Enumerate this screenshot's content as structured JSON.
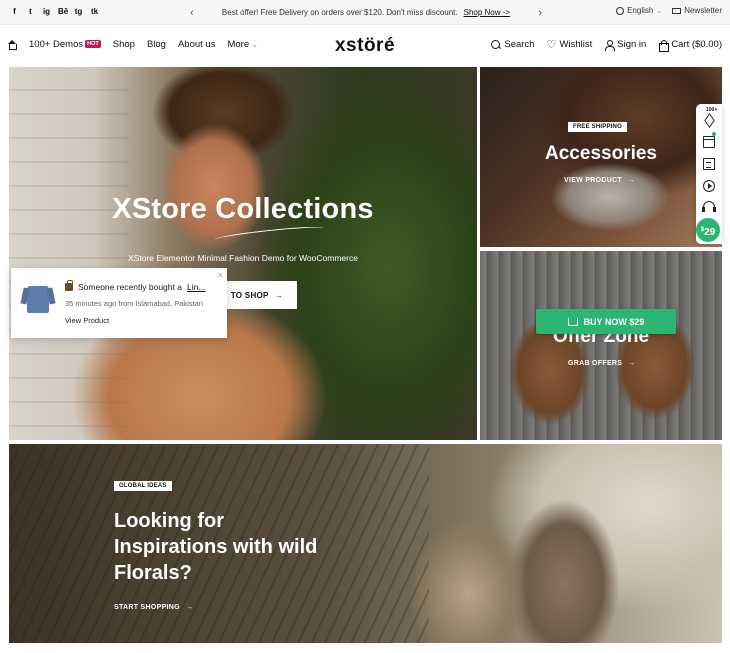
{
  "topbar": {
    "socials": [
      "f",
      "t",
      "ig",
      "Bē",
      "tg",
      "tk"
    ],
    "social_names": [
      "facebook-icon",
      "twitter-icon",
      "instagram-icon",
      "behance-icon",
      "telegram-icon",
      "tiktok-icon"
    ],
    "promo_text": "Best offer! Free Delivery on orders over $120. Don't miss discount.",
    "promo_link": "Shop Now ->",
    "prev_arrow": "‹",
    "next_arrow": "›",
    "language": "English",
    "language_chevron": "⌄",
    "newsletter": "Newsletter"
  },
  "header": {
    "nav": {
      "demos": "100+ Demos",
      "hot": "HOT",
      "shop": "Shop",
      "blog": "Blog",
      "about": "About us",
      "more": "More",
      "more_chevron": "⌄"
    },
    "logo": "xstöré",
    "actions": {
      "search": "Search",
      "wishlist": "Wishlist",
      "sign_in": "Sign in",
      "cart": "Cart ($0.00)"
    }
  },
  "hero": {
    "title": "XStore Collections",
    "subtitle": "XStore Elementor Minimal Fashion Demo for WooCommerce",
    "button": "TO SHOP",
    "button_arrow": "→"
  },
  "accessories": {
    "badge": "FREE SHIPPING",
    "title": "Accessories",
    "link": "VIEW PRODUCT",
    "arrow": "→"
  },
  "offer": {
    "title": "Offer Zone",
    "link": "GRAB OFFERS",
    "arrow": "→",
    "buy_button": "BUY NOW $29"
  },
  "banner": {
    "badge": "GLOBAL IDEAS",
    "title_lines": [
      "Looking for",
      "Inspirations with wild",
      "Florals?"
    ],
    "link": "START SHOPPING",
    "arrow": "→"
  },
  "popup": {
    "line1_prefix": "Someone recently bought a",
    "line1_link": "Lin...",
    "line2": "35 minutes ago from Islamabad, Pakistan",
    "line3": "View Product",
    "close": "×"
  },
  "sidebar": {
    "demo_count": "100+",
    "price": "29",
    "price_currency": "$"
  },
  "colors": {
    "accent_green": "#2bb673",
    "hot_badge": "#c2185b"
  }
}
